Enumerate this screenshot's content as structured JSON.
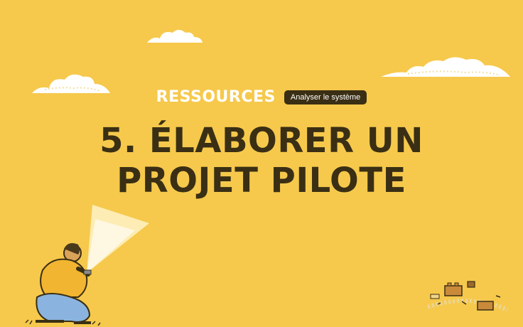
{
  "header": {
    "section_label": "RESSOURCES",
    "tag": "Analyser le système"
  },
  "title": {
    "line1": "5. ÉLABORER UN",
    "line2": "PROJET PILOTE"
  },
  "colors": {
    "background": "#f6c94c",
    "title": "#3a2f14",
    "tag_bg": "#3a2f14",
    "cloud": "#ffffff"
  },
  "icons": [
    "cloud-icon",
    "person-with-flashlight-illustration",
    "scattered-blocks-illustration"
  ]
}
